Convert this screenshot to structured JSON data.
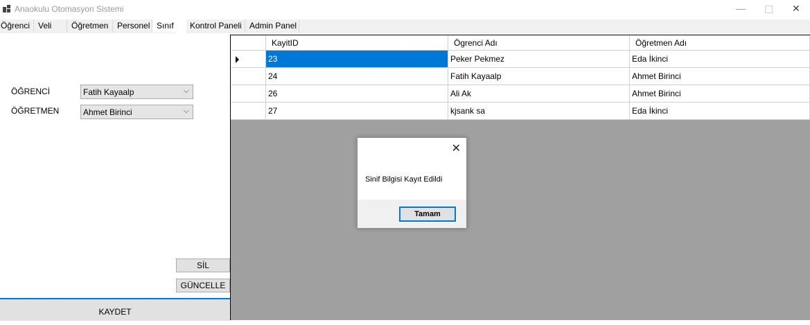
{
  "window": {
    "title": "Anaokulu Otomasyon Sistemi"
  },
  "tabs": [
    "Öğrenci",
    "Veli",
    "Öğretmen",
    "Personel",
    "Sınıf",
    "Kontrol Paneli",
    "Admin Panel"
  ],
  "form": {
    "ogrenci_label": "ÖĞRENCİ",
    "ogrenci_value": "Fatih Kayaalp",
    "ogretmen_label": "ÖĞRETMEN",
    "ogretmen_value": "Ahmet Birinci"
  },
  "buttons": {
    "sil": "SİL",
    "guncelle": "GÜNCELLE",
    "kaydet": "KAYDET"
  },
  "grid": {
    "columns": [
      "KayitID",
      "Ögrenci Adı",
      "Öğretmen Adı"
    ],
    "rows": [
      [
        "23",
        "Peker Pekmez",
        "Eda İkinci"
      ],
      [
        "24",
        "Fatih Kayaalp",
        "Ahmet Birinci"
      ],
      [
        "26",
        "Ali Ak",
        "Ahmet Birinci"
      ],
      [
        "27",
        "kjsank sa",
        "Eda İkinci"
      ]
    ]
  },
  "dialog": {
    "message": "Sinif Bilgisi Kayıt Edildi",
    "ok_label": "Tamam"
  },
  "colors": {
    "accent": "#0078d7",
    "grid_bg": "#a0a0a0"
  }
}
